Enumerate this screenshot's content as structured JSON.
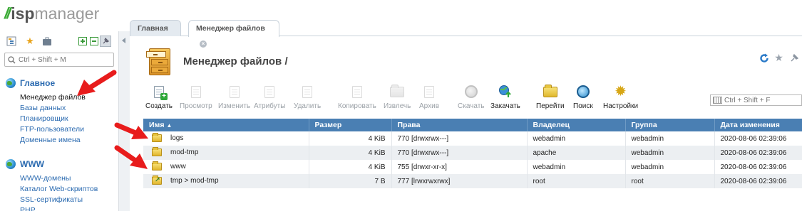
{
  "logo": {
    "mark": "//",
    "part1": "isp",
    "part2": "manager"
  },
  "sidebar": {
    "search_placeholder": "Ctrl + Shift + M",
    "groups": [
      {
        "title": "Главное",
        "items": [
          "Менеджер файлов",
          "Базы данных",
          "Планировщик",
          "FTP-пользователи",
          "Доменные имена"
        ]
      },
      {
        "title": "WWW",
        "items": [
          "WWW-домены",
          "Каталог Web-скриптов",
          "SSL-сертификаты",
          "PHP"
        ]
      }
    ]
  },
  "tabs": [
    {
      "label": "Главная"
    },
    {
      "label": "Менеджер файлов"
    }
  ],
  "header": {
    "title": "Менеджер файлов /"
  },
  "toolbar": {
    "buttons": [
      {
        "label": "Создать",
        "icon": "new-file-icon",
        "enabled": true
      },
      {
        "label": "Просмотр",
        "icon": "view-icon",
        "enabled": false
      },
      {
        "label": "Изменить",
        "icon": "edit-icon",
        "enabled": false
      },
      {
        "label": "Атрибуты",
        "icon": "attributes-icon",
        "enabled": false
      },
      {
        "label": "Удалить",
        "icon": "delete-icon",
        "enabled": false
      },
      {
        "label": "Копировать",
        "icon": "copy-icon",
        "enabled": false
      },
      {
        "label": "Извлечь",
        "icon": "extract-icon",
        "enabled": false
      },
      {
        "label": "Архив",
        "icon": "archive-icon",
        "enabled": false
      },
      {
        "label": "Скачать",
        "icon": "download-icon",
        "enabled": false
      },
      {
        "label": "Закачать",
        "icon": "upload-icon",
        "enabled": true
      },
      {
        "label": "Перейти",
        "icon": "folder-icon",
        "enabled": true
      },
      {
        "label": "Поиск",
        "icon": "search-icon",
        "enabled": true
      },
      {
        "label": "Настройки",
        "icon": "gear-icon",
        "enabled": true
      }
    ],
    "search_placeholder": "Ctrl + Shift + F"
  },
  "table": {
    "columns": [
      "Имя",
      "Размер",
      "Права",
      "Владелец",
      "Группа",
      "Дата изменения"
    ],
    "rows": [
      {
        "name": "logs",
        "size": "4 KiB",
        "perms": "770 [drwxrwx---]",
        "owner": "webadmin",
        "group": "webadmin",
        "date": "2020-08-06 02:39:06",
        "type": "folder"
      },
      {
        "name": "mod-tmp",
        "size": "4 KiB",
        "perms": "770 [drwxrwx---]",
        "owner": "apache",
        "group": "webadmin",
        "date": "2020-08-06 02:39:06",
        "type": "folder"
      },
      {
        "name": "www",
        "size": "4 KiB",
        "perms": "755 [drwxr-xr-x]",
        "owner": "webadmin",
        "group": "webadmin",
        "date": "2020-08-06 02:39:06",
        "type": "folder"
      },
      {
        "name": "tmp > mod-tmp",
        "size": "7 B",
        "perms": "777 [lrwxrwxrwx]",
        "owner": "root",
        "group": "root",
        "date": "2020-08-06 02:39:06",
        "type": "symlink"
      }
    ]
  },
  "colors": {
    "accent": "#4a7fb3",
    "link": "#2a6ab0",
    "arrow": "#e81c1c"
  }
}
